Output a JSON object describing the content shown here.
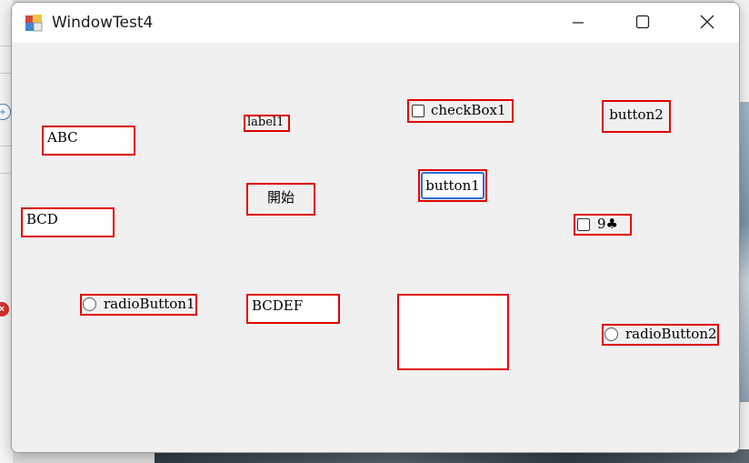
{
  "window": {
    "title": "WindowTest4"
  },
  "controls": {
    "textbox_abc": "ABC",
    "label1": "label1",
    "checkbox1": "checkBox1",
    "button2": "button2",
    "start_button": "開始",
    "button1": "button1",
    "textbox_bcd": "BCD",
    "checkbox_nine": "9♣",
    "radio1": "radioButton1",
    "textbox_bcdef": "BCDEF",
    "radio2": "radioButton2"
  },
  "colors": {
    "highlight": "#e00000",
    "window_bg": "#f0f0f0",
    "focus_border": "#2f6fd0"
  }
}
